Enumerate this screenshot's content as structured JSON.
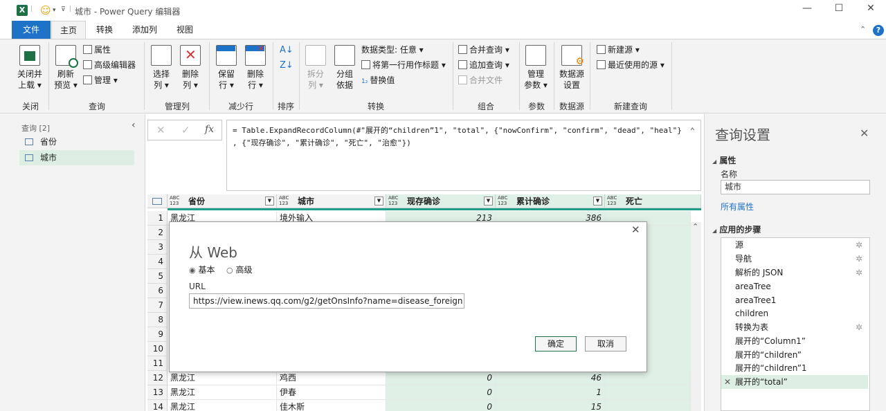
{
  "window": {
    "title": "城市 - Power Query 编辑器",
    "minimize": "—",
    "maximize": "☐",
    "close": "✕"
  },
  "tabs": [
    "文件",
    "主页",
    "转换",
    "添加列",
    "视图"
  ],
  "ribbon": {
    "close_group": {
      "label": "关闭",
      "btn1": "关闭并",
      "btn2": "上载"
    },
    "query_group": {
      "label": "查询",
      "refresh1": "刷新",
      "refresh2": "预览",
      "properties": "属性",
      "adv_editor": "高级编辑器",
      "manage": "管理"
    },
    "cols_group": {
      "label": "管理列",
      "choose1": "选择",
      "choose2": "列",
      "remove1": "删除",
      "remove2": "列"
    },
    "rows_group": {
      "label": "减少行",
      "keep1": "保留",
      "keep2": "行",
      "rrm1": "删除",
      "rrm2": "行"
    },
    "sort_group": {
      "label": "排序"
    },
    "transform_group": {
      "label": "转换",
      "split1": "拆分",
      "split2": "列",
      "groupby1": "分组",
      "groupby2": "依据",
      "datatype": "数据类型: 任意",
      "firstrow": "将第一行用作标题",
      "replace": "替换值"
    },
    "combine_group": {
      "label": "组合",
      "merge": "合并查询",
      "append": "追加查询",
      "combine_files": "合并文件"
    },
    "params_group": {
      "label": "参数",
      "manage1": "管理",
      "manage2": "参数"
    },
    "ds_group": {
      "label": "数据源",
      "ds1": "数据源",
      "ds2": "设置"
    },
    "new_group": {
      "label": "新建查询",
      "new_source": "新建源",
      "recent": "最近使用的源"
    }
  },
  "queries": {
    "header": "查询 [2]",
    "items": [
      "省份",
      "城市"
    ]
  },
  "formula": {
    "line1": "= Table.ExpandRecordColumn(#\"展开的“children”1\", \"total\", {\"nowConfirm\", \"confirm\", \"dead\", \"heal\"}",
    "line2": "    , {\"现存确诊\", \"累计确诊\", \"死亡\", \"治愈\"})"
  },
  "grid": {
    "type_abc": "ABC",
    "type_123": "123",
    "columns": [
      "省份",
      "城市",
      "现存确诊",
      "累计确诊",
      "死亡"
    ],
    "row_numbers": [
      "1",
      "2",
      "3",
      "4",
      "5",
      "6",
      "7",
      "8",
      "9",
      "10",
      "11",
      "12",
      "13",
      "14"
    ],
    "rows": [
      {
        "n": "1",
        "prov": "黑龙江",
        "city": "境外输入",
        "now": "213",
        "total": "386"
      },
      {
        "n": "12",
        "prov": "黑龙江",
        "city": "鸡西",
        "now": "0",
        "total": "46"
      },
      {
        "n": "13",
        "prov": "黑龙江",
        "city": "伊春",
        "now": "0",
        "total": "1"
      },
      {
        "n": "14",
        "prov": "黑龙江",
        "city": "佳木斯",
        "now": "0",
        "total": "15"
      }
    ]
  },
  "settings": {
    "title": "查询设置",
    "props_header": "属性",
    "name_label": "名称",
    "name_value": "城市",
    "all_props": "所有属性",
    "steps_header": "应用的步骤",
    "steps": [
      "源",
      "导航",
      "解析的 JSON",
      "areaTree",
      "areaTree1",
      "children",
      "转换为表",
      "展开的“Column1”",
      "展开的“children”",
      "展开的“children”1",
      "展开的“total”"
    ]
  },
  "dialog": {
    "title": "从 Web",
    "basic": "基本",
    "advanced": "高级",
    "url_label": "URL",
    "url_value": "https://view.inews.qq.com/g2/getOnsInfo?name=disease_foreign",
    "ok": "确定",
    "cancel": "取消"
  }
}
